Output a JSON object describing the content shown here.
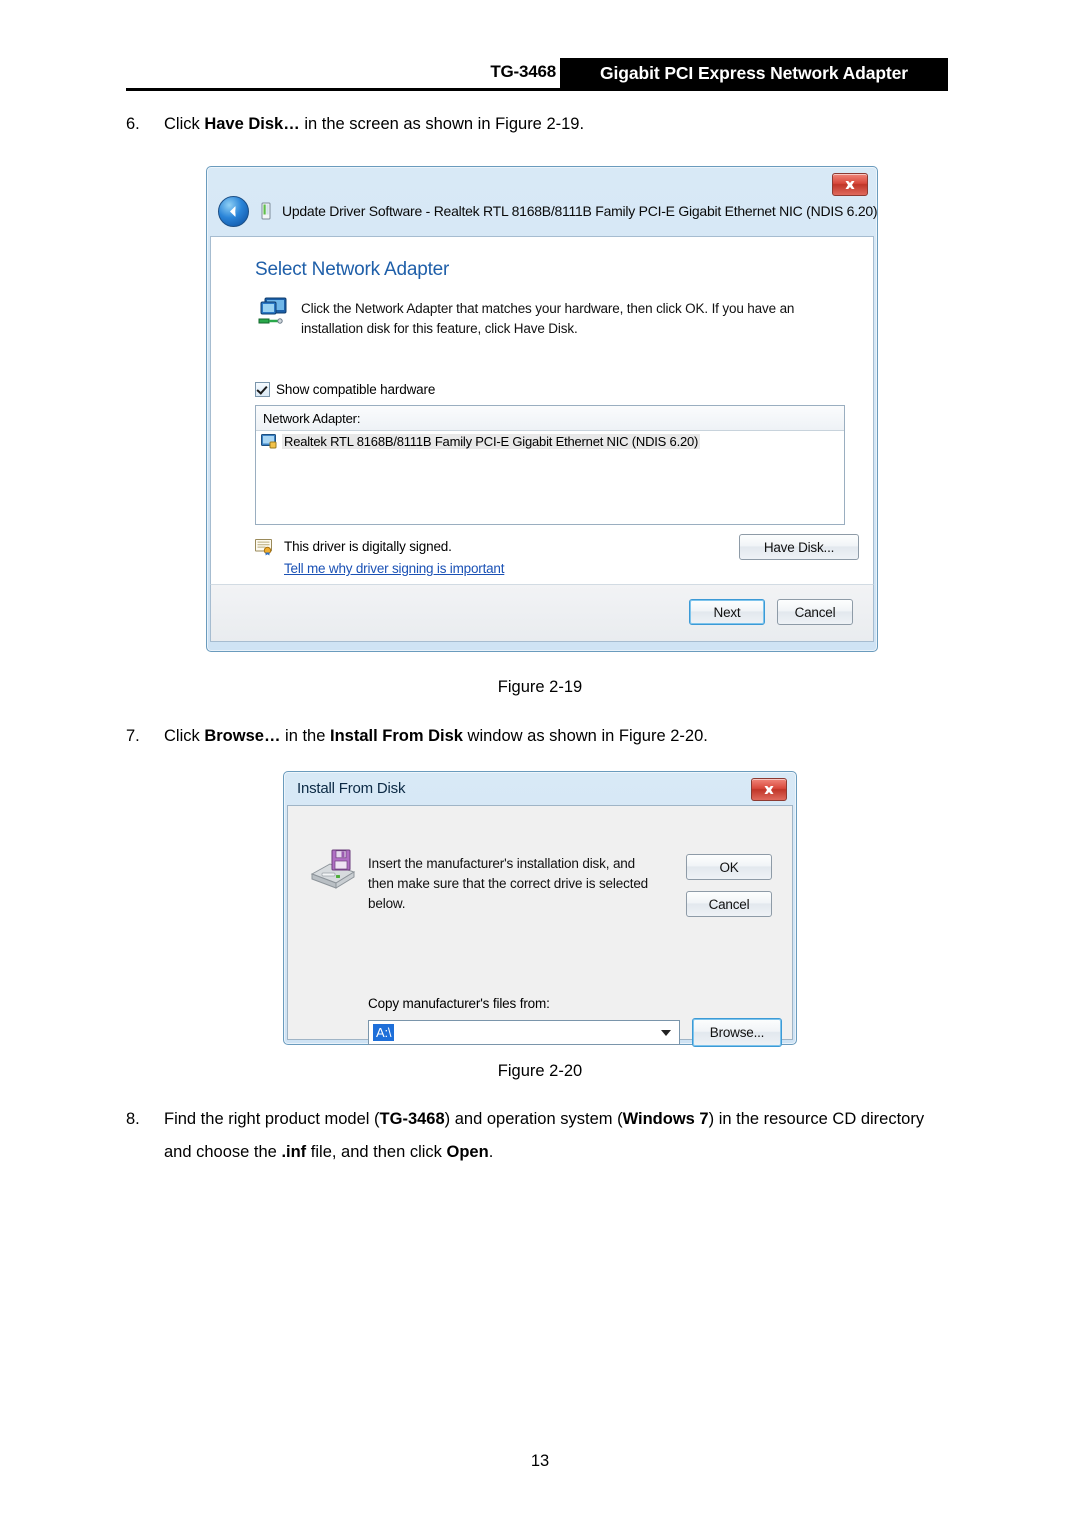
{
  "header": {
    "model": "TG-3468",
    "banner": "Gigabit PCI Express Network Adapter"
  },
  "steps": {
    "step6": {
      "number": "6.",
      "text_before": "Click ",
      "bold1": "Have Disk…",
      "text_mid": " in the screen as shown in ",
      "text_after": "Figure 2-19."
    },
    "step7": {
      "number": "7.",
      "text_before": "Click ",
      "bold1": "Browse…",
      "text_mid": " in the ",
      "bold2": "Install From Disk",
      "text_mid2": " window as shown in ",
      "text_after": "Figure 2-20."
    },
    "step8": {
      "number": "8.",
      "part1": "Find the right product model (",
      "bold1": "TG-3468",
      "part2": ") and operation system (",
      "bold2": "Windows 7",
      "part3": ") in the resource CD directory and choose the ",
      "bold3": ".inf",
      "part4": " file, and then click ",
      "bold4": "Open",
      "part5": "."
    }
  },
  "captions": {
    "fig219": "Figure 2-19",
    "fig220": "Figure 2-20"
  },
  "page_number": "13",
  "dialog_update": {
    "title": "Update Driver Software - Realtek RTL 8168B/8111B Family PCI-E Gigabit Ethernet NIC (NDIS 6.20)",
    "heading": "Select Network Adapter",
    "description": "Click the Network Adapter that matches your hardware, then click OK. If you have an installation disk for this feature, click Have Disk.",
    "checkbox_label": "Show compatible hardware",
    "checkbox_checked": true,
    "list_header": "Network Adapter:",
    "list_items": [
      "Realtek RTL 8168B/8111B Family PCI-E Gigabit Ethernet NIC (NDIS 6.20)"
    ],
    "signed_text": "This driver is digitally signed.",
    "signed_link": "Tell me why driver signing is important",
    "have_disk_label": "Have Disk...",
    "next_label": "Next",
    "cancel_label": "Cancel",
    "close_icon": "close-icon",
    "back_icon": "back-arrow-icon"
  },
  "dialog_install": {
    "title": "Install From Disk",
    "description": "Insert the manufacturer's installation disk, and then make sure that the correct drive is selected below.",
    "ok_label": "OK",
    "cancel_label": "Cancel",
    "copy_from_label": "Copy manufacturer's files from:",
    "path_value": "A:\\",
    "browse_label": "Browse...",
    "close_icon": "close-icon"
  },
  "colors": {
    "banner_bg": "#000000",
    "link": "#1a51b5",
    "heading_blue": "#1f5fa9",
    "close_red": "#c03528",
    "selection_blue": "#1e6fd9"
  }
}
